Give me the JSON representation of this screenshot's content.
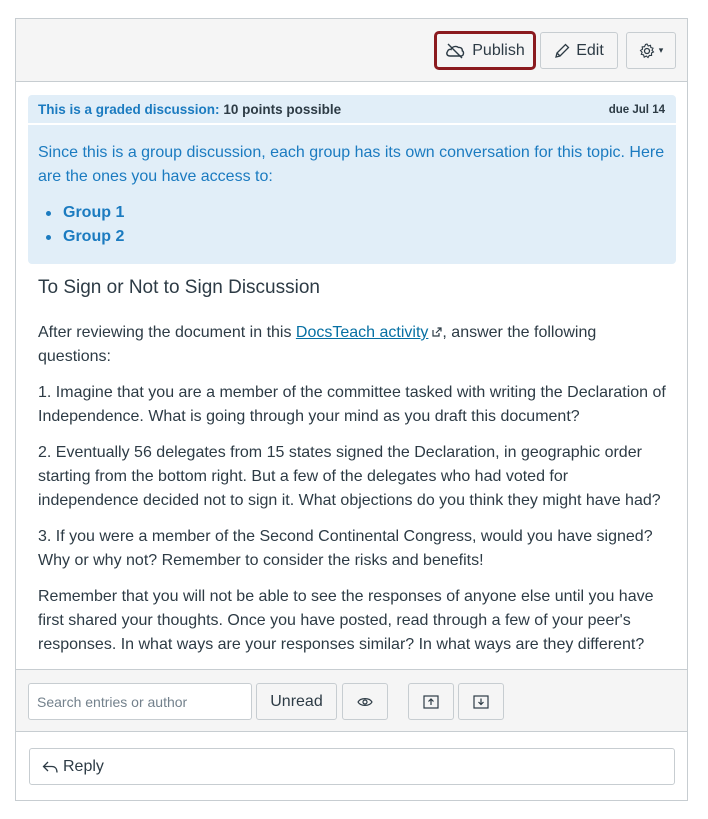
{
  "toolbar": {
    "publish_label": "Publish",
    "edit_label": "Edit",
    "settings_caret": "▾"
  },
  "graded": {
    "label": "This is a graded discussion:",
    "points": "10 points possible",
    "due": "due Jul 14",
    "group_text": "Since this is a group discussion, each group has its own conversation for this topic. Here are the ones you have access to:",
    "groups": [
      "Group 1",
      "Group 2"
    ]
  },
  "topic": {
    "title": "To Sign or Not to Sign Discussion",
    "intro_before": "After reviewing the document in this ",
    "intro_link": "DocsTeach activity",
    "intro_after": ", answer the following questions:",
    "q1": "1. Imagine that you are a member of the committee tasked with writing the Declaration of Independence. What is going through your mind as you draft this document?",
    "q2": "2. Eventually 56 delegates from 15 states signed the Declaration, in geographic order starting from the bottom right. But a few of the delegates who had voted for independence decided not to sign it. What objections do you think they might have had?",
    "q3": "3. If you were a member of the Second Continental Congress, would you have signed? Why or why not? Remember to consider the risks and benefits!",
    "closing": "Remember that you will not be able to see the responses of anyone else until you have first shared your thoughts. Once you have posted, read through a few of your peer's responses. In what ways are your responses similar? In what ways are they different?"
  },
  "filters": {
    "search_placeholder": "Search entries or author",
    "unread_label": "Unread"
  },
  "reply": {
    "label": "Reply"
  },
  "colors": {
    "accent": "#1b7bc0",
    "publish_border": "#8b1a1f",
    "info_bg": "#e1eef8"
  }
}
